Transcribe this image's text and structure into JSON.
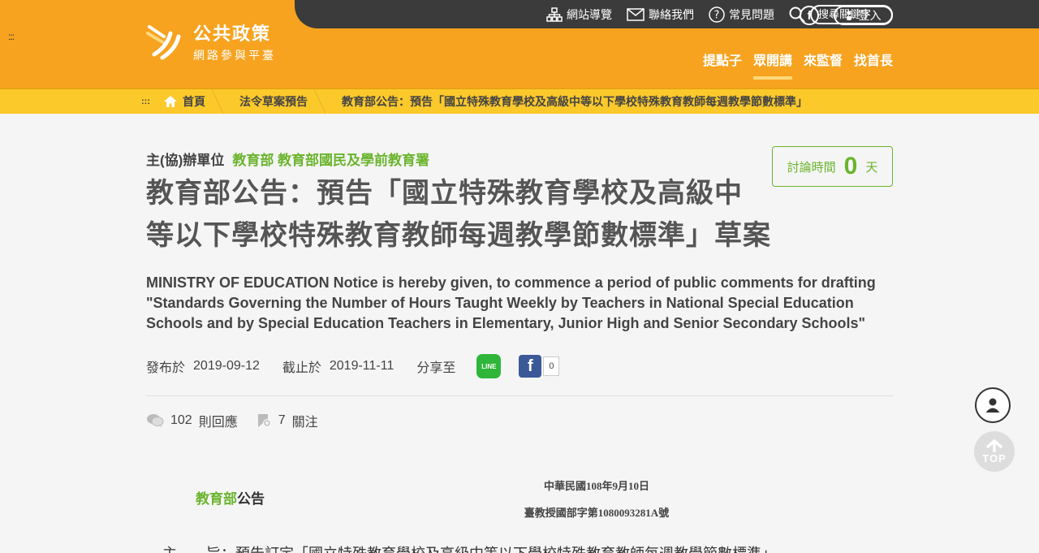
{
  "header": {
    "menu_glyph": ":::",
    "logo_title": "公共政策",
    "logo_sub": "網路參與平臺",
    "top_links": [
      "網站導覽",
      "聯絡我們",
      "常見問題"
    ],
    "search_placeholder": "搜尋關鍵字",
    "facebook_glyph": "f",
    "login_label": "登入",
    "nav": [
      "提點子",
      "眾開講",
      "來監督",
      "找首長"
    ],
    "nav_active_index": 1
  },
  "breadcrumb": {
    "menu_glyph": ":::",
    "home": "首頁",
    "level2": "法令草案預告",
    "current": "教育部公告：預告「國立特殊教育學校及高級中等以下學校特殊教育教師每週教學節數標準」"
  },
  "content": {
    "unit_label": "主(協)辦單位",
    "unit_value": "教育部 教育部國民及學前教育署",
    "title_line1": "教育部公告：預告「國立特殊教育學校及高級中",
    "title_line2": "等以下學校特殊教育教師每週教學節數標準」草案",
    "discussion_label": "討論時間",
    "discussion_days": "0",
    "discussion_unit": "天",
    "en_title": "MINISTRY OF EDUCATION Notice is hereby given, to commence a period of public comments for drafting \"Standards Governing the Number of Hours Taught Weekly by Teachers in National Special Education Schools and by Special Education Teachers in Elementary, Junior High and Senior Secondary Schools\"",
    "published_label": "發布於",
    "published_date": "2019-09-12",
    "deadline_label": "截止於",
    "deadline_date": "2019-11-11",
    "share_label": "分享至",
    "line_label": "LINE",
    "facebook_glyph": "f",
    "facebook_count": "0",
    "replies_count": "102",
    "replies_label": "則回應",
    "follow_count": "7",
    "follow_label": "關注"
  },
  "document": {
    "head_green": "教育部",
    "head_rest": "公告",
    "date": "中華民國108年9月10日",
    "number": "臺教授國部字第1080093281A號",
    "subject": "主　　旨：預告訂定「國立特殊教育學校及高級中等以下學校特殊教育教師每週教學節數標準」。"
  },
  "fab": {
    "top_label": "TOP"
  },
  "colors": {
    "brand_orange": "#f7a31f",
    "breadcrumb_yellow": "#fcc92b",
    "accent_green": "#6bb42d",
    "topbar_dark": "#3b3b3b"
  }
}
